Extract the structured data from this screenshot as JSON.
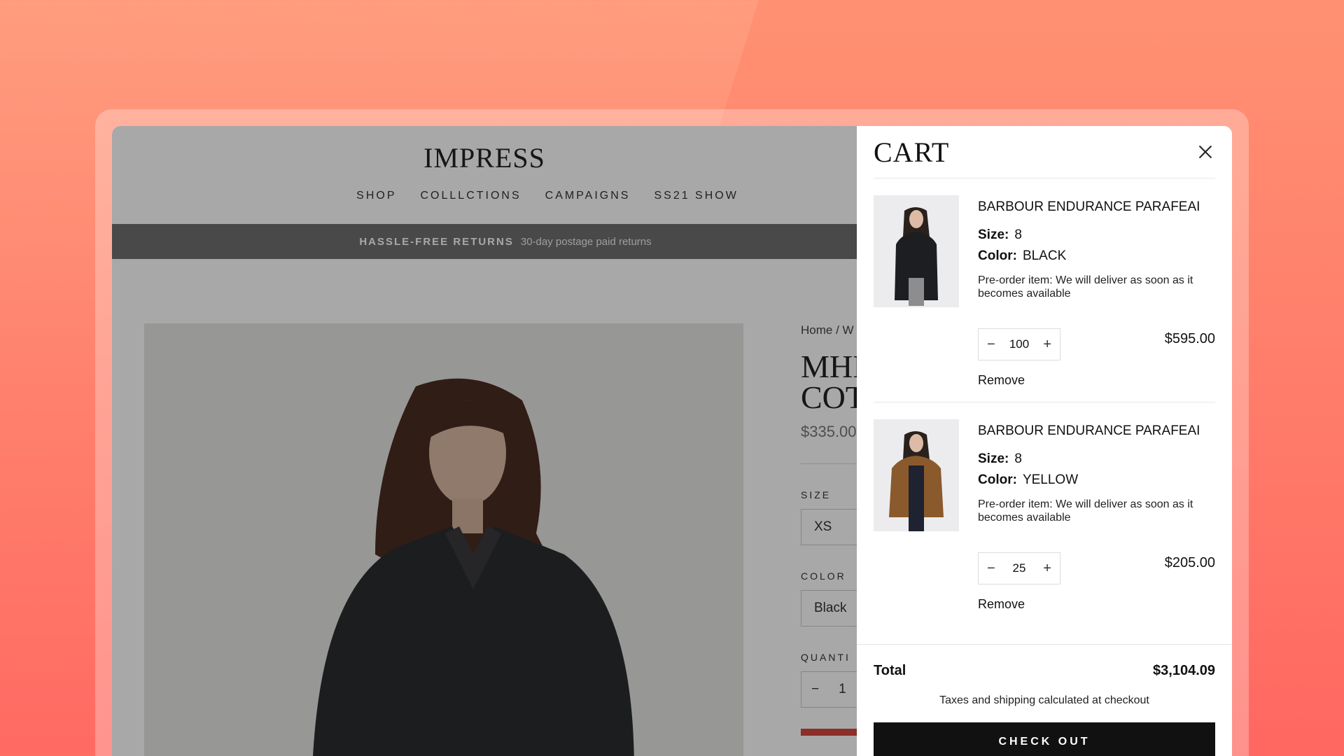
{
  "store": {
    "logo": "IMPRESS",
    "nav": [
      "SHOP",
      "COLLLCTIONS",
      "CAMPAIGNS",
      "SS21 SHOW"
    ],
    "promo_strong": "HASSLE-FREE RETURNS",
    "promo_text": "30-day postage paid returns"
  },
  "product": {
    "breadcrumb": "Home / W",
    "title_line1": "MHI",
    "title_line2": "COT",
    "price": "$335.00",
    "size_label": "SIZE",
    "size_value": "XS",
    "color_label": "COLOR",
    "color_value": "Black",
    "quantity_label": "QUANTI",
    "quantity_minus": "−",
    "quantity_value": "1"
  },
  "cart": {
    "title": "CART",
    "items": [
      {
        "name": "BARBOUR ENDURANCE PARAFEAI",
        "size_label": "Size:",
        "size": "8",
        "color_label": "Color:",
        "color": "BLACK",
        "note": "Pre-order item: We will deliver as soon as it becomes available",
        "quantity": "100",
        "price": "$595.00",
        "remove": "Remove",
        "jacket_color": "#1d1e22"
      },
      {
        "name": "BARBOUR ENDURANCE PARAFEAI",
        "size_label": "Size:",
        "size": "8",
        "color_label": "Color:",
        "color": "YELLOW",
        "note": "Pre-order item: We will deliver as soon as it becomes available",
        "quantity": "25",
        "price": "$205.00",
        "remove": "Remove",
        "jacket_color": "#8a5a2c"
      }
    ],
    "minus": "−",
    "plus": "+",
    "total_label": "Total",
    "total_value": "$3,104.09",
    "tax_note": "Taxes and shipping calculated at checkout",
    "checkout": "CHECK OUT"
  }
}
